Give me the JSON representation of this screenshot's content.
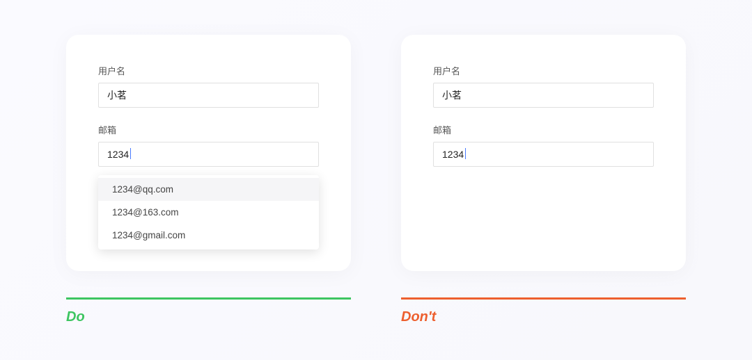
{
  "do_panel": {
    "footer_label": "Do",
    "username": {
      "label": "用户名",
      "value": "小茗"
    },
    "email": {
      "label": "邮箱",
      "value": "1234",
      "suggestions": [
        "1234@qq.com",
        "1234@163.com",
        "1234@gmail.com"
      ]
    }
  },
  "dont_panel": {
    "footer_label": "Don't",
    "username": {
      "label": "用户名",
      "value": "小茗"
    },
    "email": {
      "label": "邮箱",
      "value": "1234"
    }
  },
  "colors": {
    "do": "#3dc561",
    "dont": "#ed5f2e"
  }
}
